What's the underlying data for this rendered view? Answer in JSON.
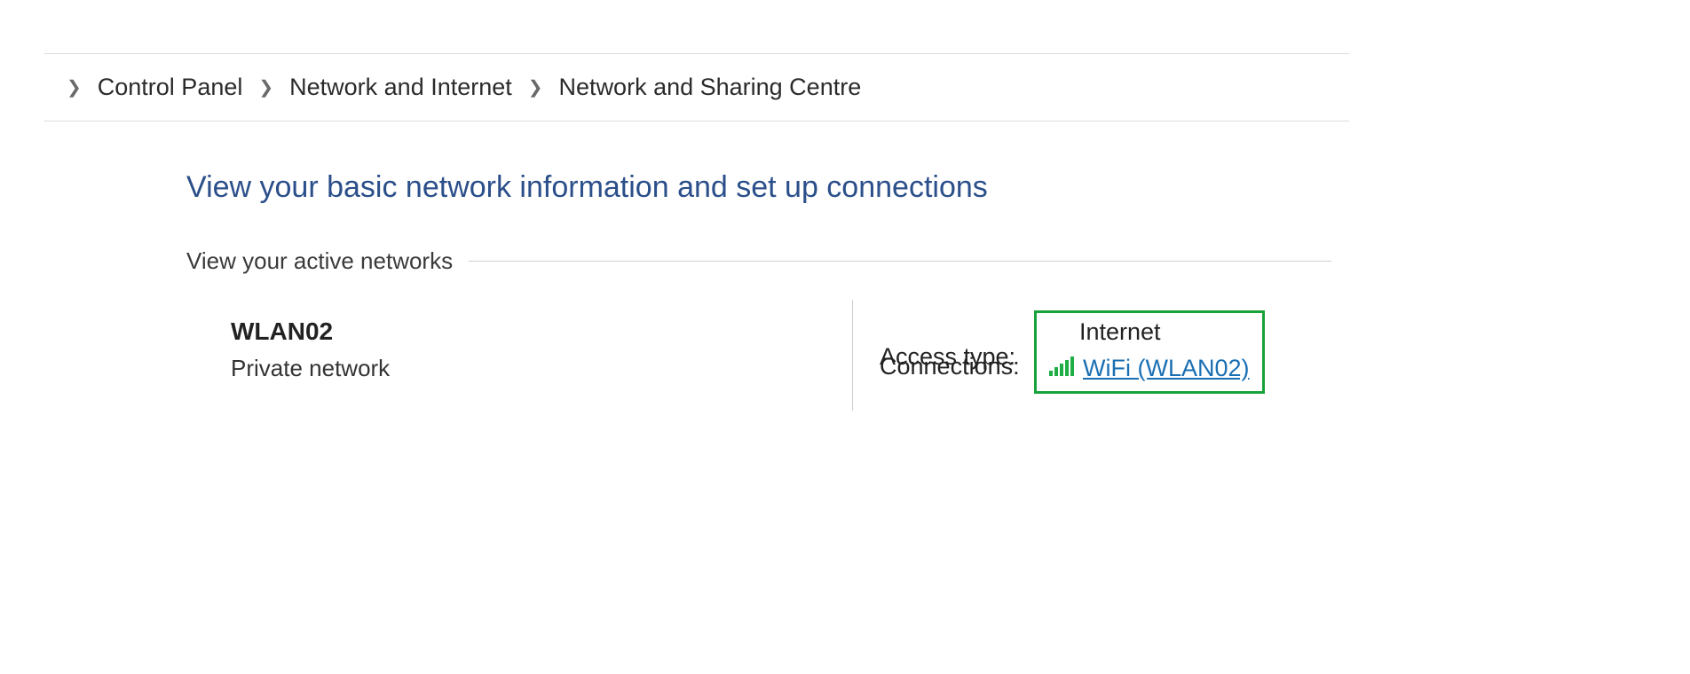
{
  "breadcrumbs": {
    "items": [
      {
        "label": "Control Panel"
      },
      {
        "label": "Network and Internet"
      },
      {
        "label": "Network and Sharing Centre"
      }
    ]
  },
  "page": {
    "heading": "View your basic network information and set up connections",
    "section_label": "View your active networks"
  },
  "network": {
    "name": "WLAN02",
    "category": "Private network",
    "access_type_label": "Access type:",
    "access_type_value": "Internet",
    "connections_label": "Connections:",
    "connection_link": "WiFi (WLAN02)"
  },
  "colors": {
    "heading": "#2b4f8a",
    "link": "#1a6fb3",
    "highlight": "#17a23a"
  }
}
